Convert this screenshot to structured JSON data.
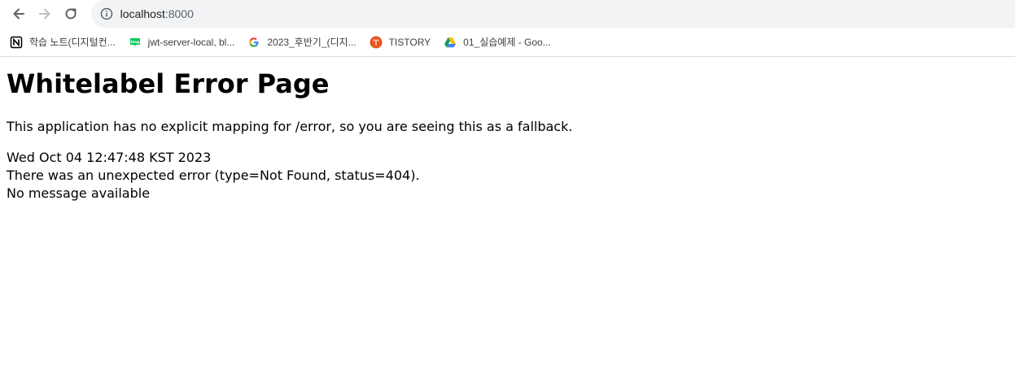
{
  "browser": {
    "url_host": "localhost",
    "url_port": ":8000",
    "icons": {
      "back": "arrow-left-icon",
      "forward": "arrow-right-icon",
      "reload": "reload-icon",
      "site_info": "info-icon"
    }
  },
  "bookmarks": [
    {
      "label": "학습 노트(디지털컨...",
      "icon": "notion-icon"
    },
    {
      "label": "jwt-server-local, bl...",
      "icon": "blog-icon"
    },
    {
      "label": "2023_후반기_(디지...",
      "icon": "google-icon"
    },
    {
      "label": "TISTORY",
      "icon": "tistory-icon"
    },
    {
      "label": "01_실습예제 - Goo...",
      "icon": "google-drive-icon"
    }
  ],
  "page": {
    "title": "Whitelabel Error Page",
    "description": "This application has no explicit mapping for /error, so you are seeing this as a fallback.",
    "timestamp": "Wed Oct 04 12:47:48 KST 2023",
    "error_line": "There was an unexpected error (type=Not Found, status=404).",
    "message": "No message available"
  }
}
